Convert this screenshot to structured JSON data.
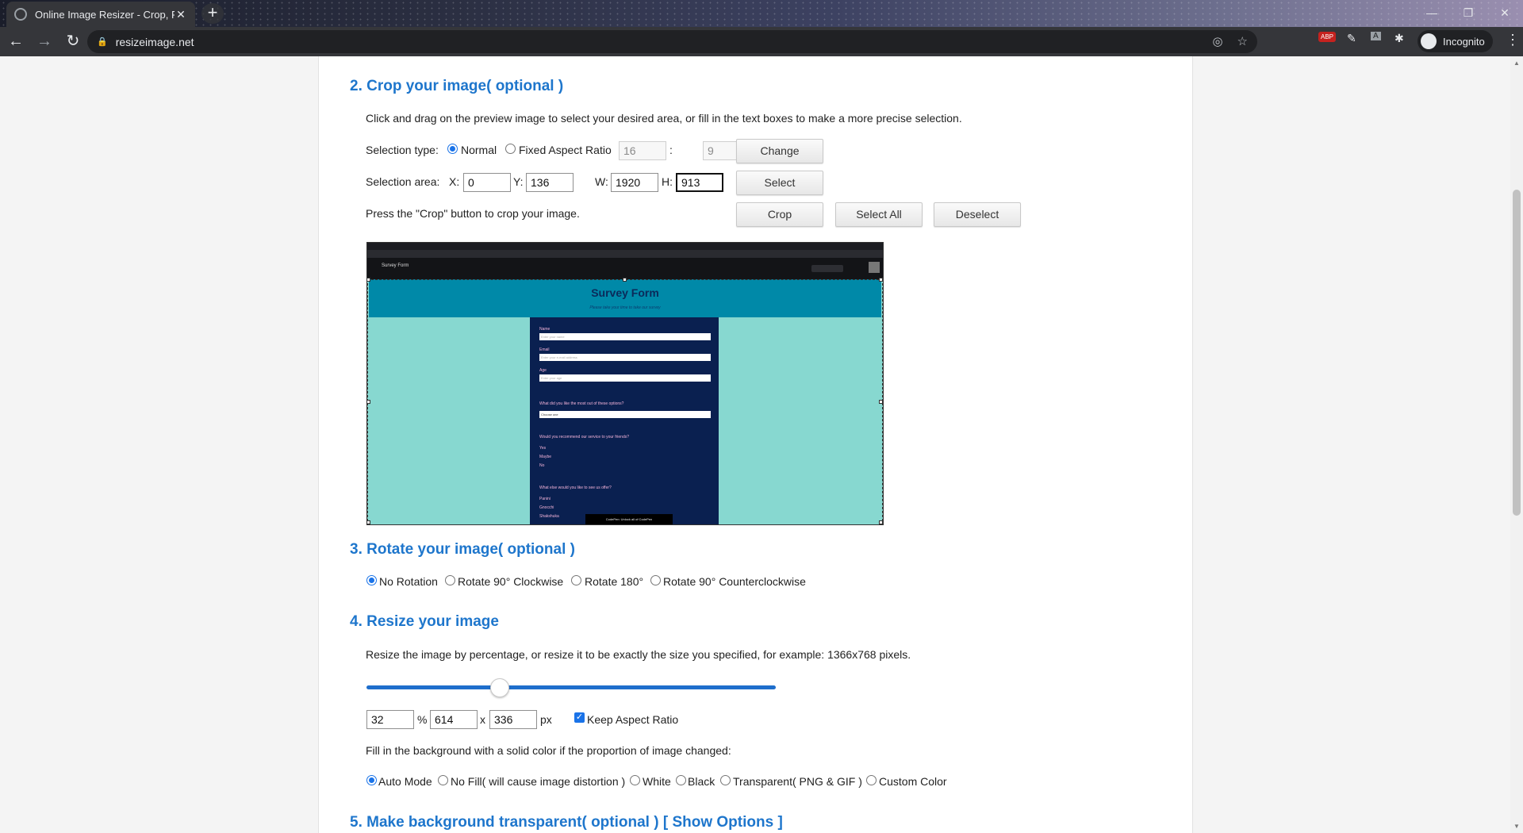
{
  "browser": {
    "tab_title": "Online Image Resizer - Crop, Res",
    "tab_close": "✕",
    "new_tab": "+",
    "url": "resizeimage.net",
    "incognito_label": "Incognito",
    "window_controls": [
      "—",
      "❐",
      "✕"
    ]
  },
  "section2": {
    "heading": "2. Crop your image( optional )",
    "intro": "Click and drag on the preview image to select your desired area, or fill in the text boxes to make a more precise selection.",
    "selection_type_label": "Selection type:",
    "normal_label": "Normal",
    "fixed_ratio_label": "Fixed Aspect Ratio",
    "ratio_w": "16",
    "ratio_sep": ":",
    "ratio_h": "9",
    "change_button": "Change",
    "selection_area_label": "Selection area:",
    "x_label": "X:",
    "x_value": "0",
    "y_label": "Y:",
    "y_value": "136",
    "w_label": "W:",
    "w_value": "1920",
    "h_label": "H:",
    "h_value": "913",
    "select_button": "Select",
    "crop_hint": "Press the \"Crop\" button to crop your image.",
    "crop_button": "Crop",
    "select_all_button": "Select All",
    "deselect_button": "Deselect"
  },
  "preview": {
    "app_title": "Survey Form",
    "change_view": "Change View",
    "form_title": "Survey Form",
    "form_subtitle": "Please take your time to take our survey",
    "name_label": "Name",
    "name_placeholder": "Enter your name",
    "email_label": "Email",
    "email_placeholder": "Enter your e-mail address",
    "age_label": "Age",
    "age_placeholder": "Enter your age",
    "q1": "What did you like the most out of these options?",
    "select_text": "Choose one",
    "q2": "Would you recommend our service to your friends?",
    "opt_yes": "Yes",
    "opt_maybe": "Maybe",
    "opt_no": "No",
    "q3": "What else would you like to see us offer?",
    "opt_panini": "Panini",
    "opt_gnocchi": "Gnocchi",
    "opt_shakshuka": "Shakshuka",
    "cta": "CodePen: Unlock all of CodePen"
  },
  "section3": {
    "heading": "3. Rotate your image( optional )",
    "options": [
      "No Rotation",
      "Rotate 90° Clockwise",
      "Rotate 180°",
      "Rotate 90° Counterclockwise"
    ]
  },
  "section4": {
    "heading": "4. Resize your image",
    "intro": "Resize the image by percentage, or resize it to be exactly the size you specified, for example: 1366x768 pixels.",
    "slider_percent": 32,
    "percent_value": "32",
    "percent_sign": "%",
    "width_value": "614",
    "x_sep": "x",
    "height_value": "336",
    "px_label": "px",
    "keep_ratio_label": "Keep Aspect Ratio",
    "fill_intro": "Fill in the background with a solid color if the proportion of image changed:",
    "fill_options": [
      "Auto Mode",
      "No Fill( will cause image distortion )",
      "White",
      "Black",
      "Transparent( PNG & GIF )",
      "Custom Color"
    ]
  },
  "section5": {
    "heading": "5. Make background transparent( optional )",
    "show_options": "[ Show Options ]"
  },
  "colors": {
    "heading_blue": "#1e76cc",
    "radio_blue": "#1a73e8",
    "banner_teal": "#0089a8",
    "form_navy": "#0a2050"
  }
}
